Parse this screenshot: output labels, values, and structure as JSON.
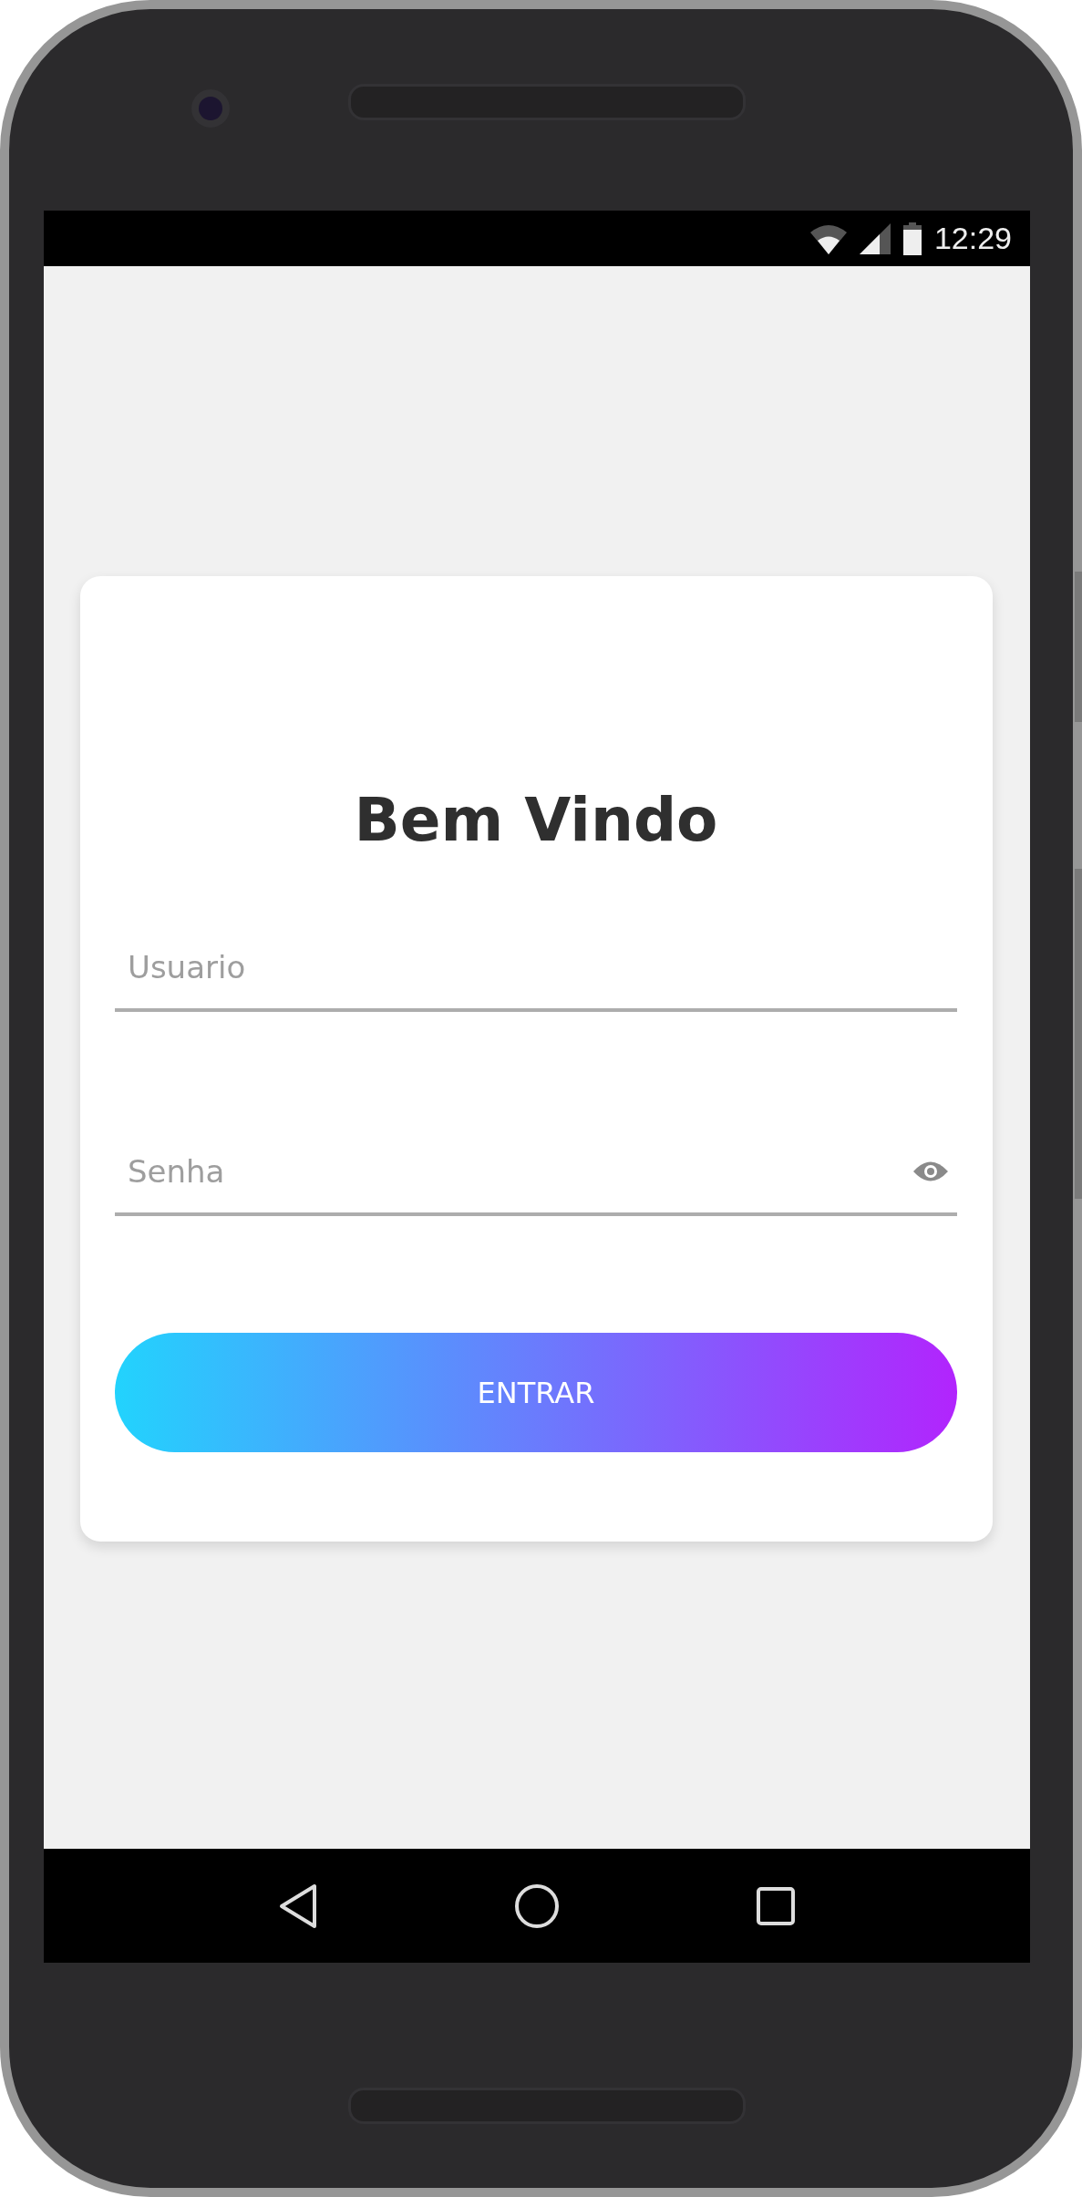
{
  "status_bar": {
    "time": "12:29"
  },
  "login_card": {
    "title": "Bem Vindo",
    "fields": [
      {
        "kind": "text",
        "placeholder": "Usuario"
      },
      {
        "kind": "password",
        "placeholder": "Senha"
      }
    ],
    "button": "ENTRAR"
  }
}
